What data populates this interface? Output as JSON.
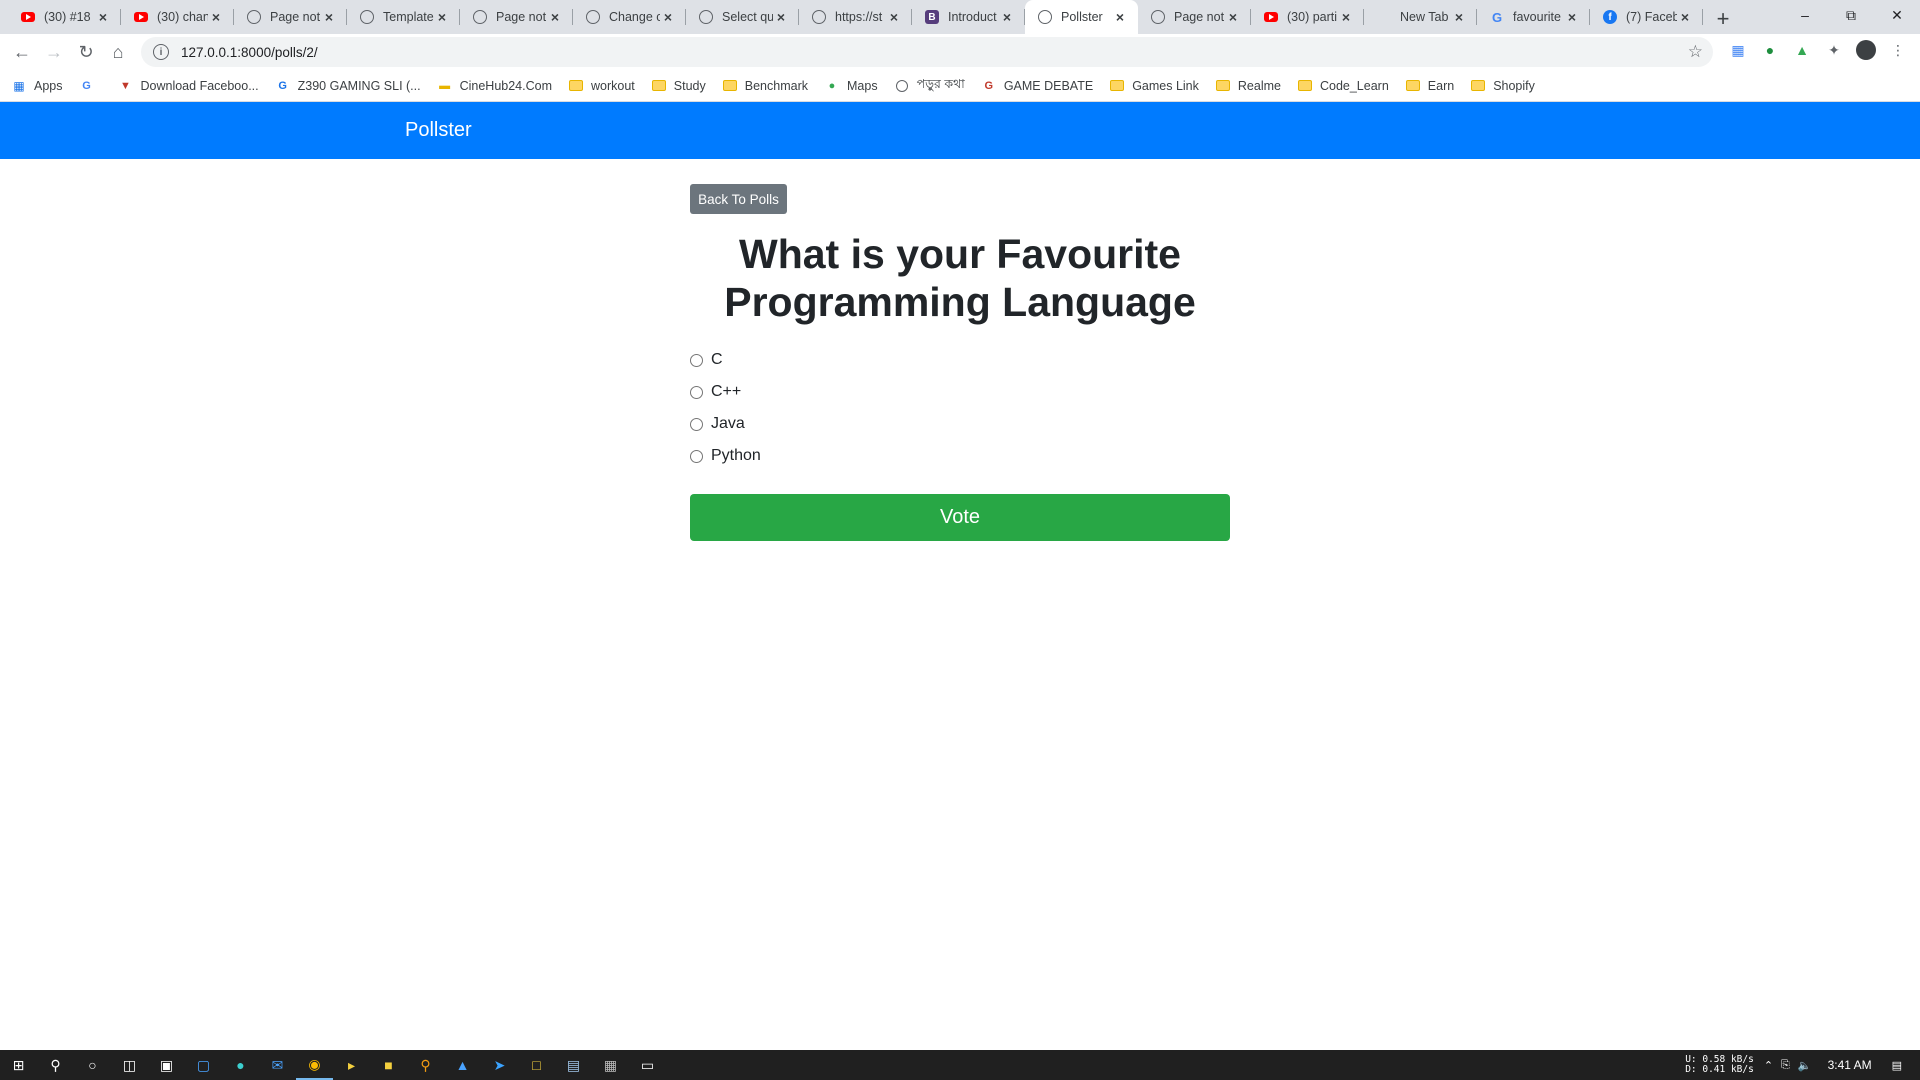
{
  "browser": {
    "tabs": [
      {
        "title": "(30) #18",
        "icon": "youtube-icon"
      },
      {
        "title": "(30) chan",
        "icon": "youtube-icon"
      },
      {
        "title": "Page not",
        "icon": "globe-icon"
      },
      {
        "title": "Template",
        "icon": "globe-icon"
      },
      {
        "title": "Page not",
        "icon": "globe-icon"
      },
      {
        "title": "Change c",
        "icon": "globe-icon"
      },
      {
        "title": "Select qu",
        "icon": "globe-icon"
      },
      {
        "title": "https://st",
        "icon": "globe-icon"
      },
      {
        "title": "Introduct",
        "icon": "bootstrap-icon"
      },
      {
        "title": "Pollster",
        "icon": "globe-icon",
        "active": true
      },
      {
        "title": "Page not",
        "icon": "globe-icon"
      },
      {
        "title": "(30) parti",
        "icon": "youtube-icon"
      },
      {
        "title": "New Tab",
        "icon": "none"
      },
      {
        "title": "favourite",
        "icon": "google-icon"
      },
      {
        "title": "(7) Faceb",
        "icon": "facebook-icon"
      }
    ],
    "url": "127.0.0.1:8000/polls/2/",
    "bookmarks": [
      {
        "label": "Apps",
        "icon": "apps-grid-icon"
      },
      {
        "label": "",
        "icon": "google-icon"
      },
      {
        "label": "Download Faceboo...",
        "icon": "download-icon"
      },
      {
        "label": "Z390 GAMING SLI (...",
        "icon": "gigabyte-icon"
      },
      {
        "label": "CineHub24.Com",
        "icon": "cinehub-icon"
      },
      {
        "label": "workout",
        "icon": "folder-icon"
      },
      {
        "label": "Study",
        "icon": "folder-icon"
      },
      {
        "label": "Benchmark",
        "icon": "folder-icon"
      },
      {
        "label": "Maps",
        "icon": "maps-icon"
      },
      {
        "label": "পড়ুর কথা",
        "icon": "globe-icon"
      },
      {
        "label": "GAME DEBATE",
        "icon": "gamedebate-icon"
      },
      {
        "label": "Games Link",
        "icon": "folder-icon"
      },
      {
        "label": "Realme",
        "icon": "folder-icon"
      },
      {
        "label": "Code_Learn",
        "icon": "folder-icon"
      },
      {
        "label": "Earn",
        "icon": "folder-icon"
      },
      {
        "label": "Shopify",
        "icon": "folder-icon"
      }
    ]
  },
  "page": {
    "brand": "Pollster",
    "back_button": "Back To Polls",
    "question": "What is your Favourite Programming Language",
    "choices": [
      "C",
      "C++",
      "Java",
      "Python"
    ],
    "vote_button": "Vote"
  },
  "taskbar": {
    "net_up": "U:   0.58 kB/s",
    "net_down": "D:   0.41 kB/s",
    "time": "3:41 AM"
  },
  "colors": {
    "navbar": "#007bff",
    "vote": "#28a745",
    "back": "#6c757d"
  }
}
